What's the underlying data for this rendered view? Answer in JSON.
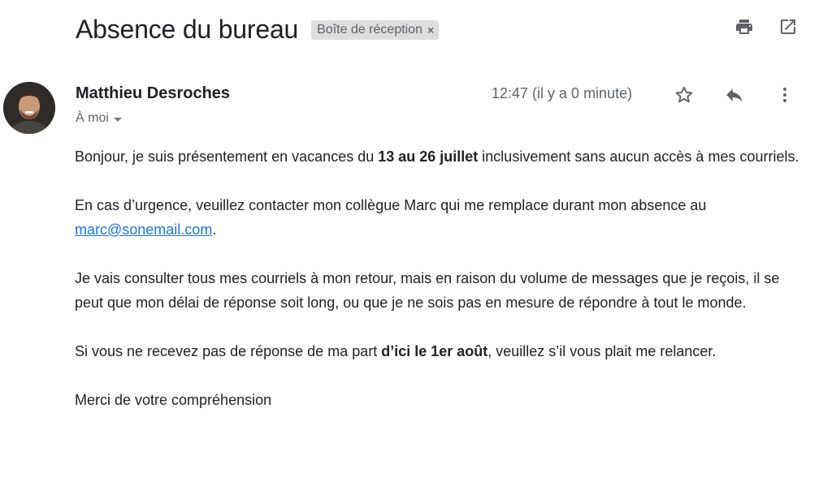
{
  "email": {
    "subject": "Absence du bureau",
    "label": "Boîte de réception",
    "label_close": "×",
    "sender_name": "Matthieu Desroches",
    "recipient": "À moi",
    "time": "12:47 (il y a 0 minute)"
  },
  "icons": {
    "print": "print-icon",
    "open_new_window": "open-in-new-window-icon",
    "star": "star-icon",
    "reply": "reply-icon",
    "more": "more-vertical-icon",
    "recipient_dropdown": "chevron-down-icon"
  },
  "body": {
    "p1_pre": "Bonjour, je suis présentement en vacances du ",
    "p1_bold": "13 au 26 juillet",
    "p1_post": " inclusivement sans aucun accès à mes courriels.",
    "p2_pre": "En cas d’urgence, veuillez contacter mon collègue Marc qui me remplace durant mon absence au ",
    "p2_link": "marc@sonemail.com",
    "p2_post": ".",
    "p3": "Je vais consulter tous mes courriels à mon retour, mais en raison du volume de messages que je reçois, il se peut que mon délai de réponse soit long, ou que je ne sois pas en mesure de répondre à tout le monde.",
    "p4_pre": "Si vous ne recevez pas de réponse de ma part ",
    "p4_bold": "d’ici le 1er août",
    "p4_post": ", veuillez s’il vous plait me relancer.",
    "p5": "Merci de votre compréhension"
  },
  "colors": {
    "link": "#1a73e8",
    "chip_background": "#dddddd",
    "secondary_text": "#5f6368",
    "icon": "#5f6368"
  }
}
